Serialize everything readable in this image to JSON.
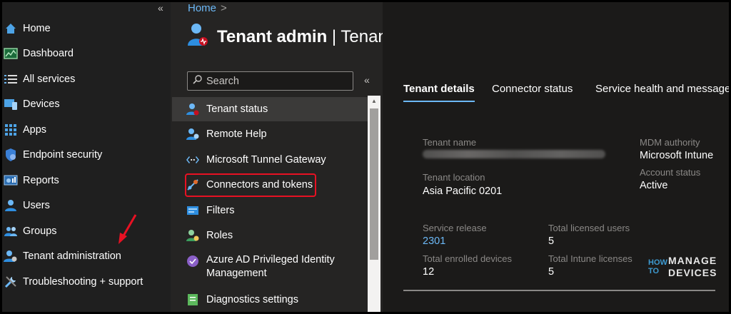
{
  "left_nav": {
    "collapse_glyph": "«",
    "items": [
      {
        "label": "Home",
        "icon": "home-icon"
      },
      {
        "label": "Dashboard",
        "icon": "dashboard-icon"
      },
      {
        "label": "All services",
        "icon": "all-services-icon"
      },
      {
        "label": "Devices",
        "icon": "devices-icon"
      },
      {
        "label": "Apps",
        "icon": "apps-icon"
      },
      {
        "label": "Endpoint security",
        "icon": "shield-icon"
      },
      {
        "label": "Reports",
        "icon": "reports-icon"
      },
      {
        "label": "Users",
        "icon": "user-icon"
      },
      {
        "label": "Groups",
        "icon": "groups-icon"
      },
      {
        "label": "Tenant administration",
        "icon": "tenant-admin-icon"
      },
      {
        "label": "Troubleshooting + support",
        "icon": "wrench-icon"
      }
    ]
  },
  "breadcrumb": {
    "home": "Home",
    "separator": ">"
  },
  "page": {
    "title_bold": "Tenant admin",
    "title_rest": " | Tenant status",
    "more": "···"
  },
  "blade": {
    "search_placeholder": "Search",
    "collapse_glyph": "«",
    "items": [
      {
        "label": "Tenant status",
        "icon": "tenant-status-icon",
        "active": true
      },
      {
        "label": "Remote Help",
        "icon": "remote-help-icon"
      },
      {
        "label": "Microsoft Tunnel Gateway",
        "icon": "tunnel-icon"
      },
      {
        "label": "Connectors and tokens",
        "icon": "connector-icon"
      },
      {
        "label": "Filters",
        "icon": "filter-icon"
      },
      {
        "label": "Roles",
        "icon": "roles-icon"
      },
      {
        "label": "Azure AD Privileged Identity Management",
        "icon": "pim-icon"
      },
      {
        "label": "Diagnostics settings",
        "icon": "diagnostics-icon"
      }
    ]
  },
  "tabs": [
    {
      "label": "Tenant details",
      "active": true
    },
    {
      "label": "Connector status"
    },
    {
      "label": "Service health and message"
    }
  ],
  "details": {
    "tenant_name_label": "Tenant name",
    "tenant_location_label": "Tenant location",
    "tenant_location": "Asia Pacific 0201",
    "mdm_authority_label": "MDM authority",
    "mdm_authority": "Microsoft Intune",
    "account_status_label": "Account status",
    "account_status": "Active",
    "service_release_label": "Service release",
    "service_release": "2301",
    "total_licensed_users_label": "Total licensed users",
    "total_licensed_users": "5",
    "total_enrolled_devices_label": "Total enrolled devices",
    "total_enrolled_devices": "12",
    "total_intune_licenses_label": "Total Intune licenses",
    "total_intune_licenses": "5"
  },
  "watermark": {
    "line1": "HOW",
    "line2": "TO",
    "word1": "MANAGE",
    "word2": "DEVICES"
  }
}
